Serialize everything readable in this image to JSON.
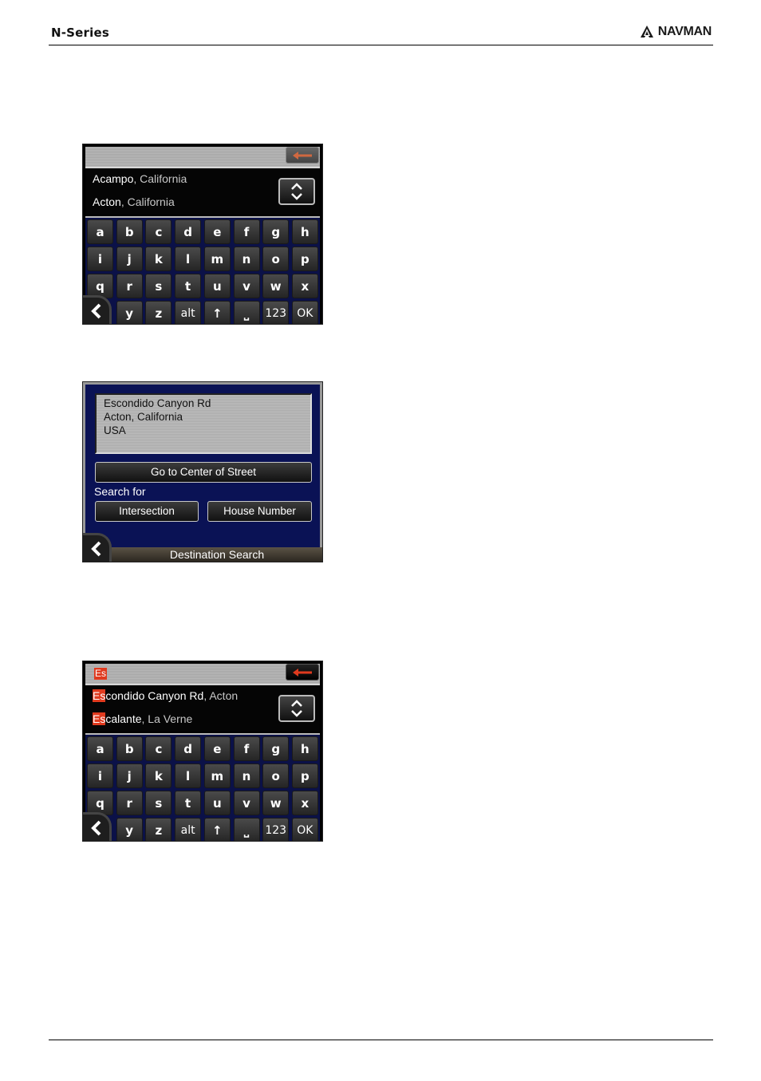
{
  "header": {
    "title": "N-Series",
    "brand": "NAVMAN",
    "brand_icon": "navman-logo-icon"
  },
  "screens": {
    "keyboard_1": {
      "typed_text": "",
      "backspace_icon": "arrow-left-icon",
      "backspace_color": "#d06840",
      "results": [
        {
          "highlight": "",
          "main": "Acampo",
          "sep": ", ",
          "sub": "California"
        },
        {
          "highlight": "",
          "main": "Acton",
          "sep": ", ",
          "sub": "California"
        }
      ],
      "scroll_icon": "up-down-chevron-icon",
      "rows": [
        [
          "a",
          "b",
          "c",
          "d",
          "e",
          "f",
          "g",
          "h"
        ],
        [
          "i",
          "j",
          "k",
          "l",
          "m",
          "n",
          "o",
          "p"
        ],
        [
          "q",
          "r",
          "s",
          "t",
          "u",
          "v",
          "w",
          "x"
        ],
        [
          "y",
          "z",
          "alt",
          "↑",
          "⎵",
          "123",
          "OK"
        ]
      ],
      "back_icon": "chevron-left-icon"
    },
    "destination": {
      "address_lines": [
        "Escondido Canyon Rd",
        "Acton, California",
        "USA"
      ],
      "center_button": "Go to Center of Street",
      "search_for_label": "Search for",
      "intersection_button": "Intersection",
      "house_number_button": "House Number",
      "bottom_title": "Destination Search",
      "back_icon": "chevron-left-icon"
    },
    "keyboard_2": {
      "typed_text": "Es",
      "backspace_icon": "arrow-left-icon",
      "backspace_color": "#e03a1e",
      "results": [
        {
          "highlight": "Es",
          "main": "condido Canyon Rd",
          "sep": ", ",
          "sub": "Acton"
        },
        {
          "highlight": "Es",
          "main": "calante",
          "sep": ", ",
          "sub": "La Verne"
        }
      ],
      "scroll_icon": "up-down-chevron-icon",
      "rows": [
        [
          "a",
          "b",
          "c",
          "d",
          "e",
          "f",
          "g",
          "h"
        ],
        [
          "i",
          "j",
          "k",
          "l",
          "m",
          "n",
          "o",
          "p"
        ],
        [
          "q",
          "r",
          "s",
          "t",
          "u",
          "v",
          "w",
          "x"
        ],
        [
          "y",
          "z",
          "alt",
          "↑",
          "⎵",
          "123",
          "OK"
        ]
      ],
      "back_icon": "chevron-left-icon"
    }
  }
}
